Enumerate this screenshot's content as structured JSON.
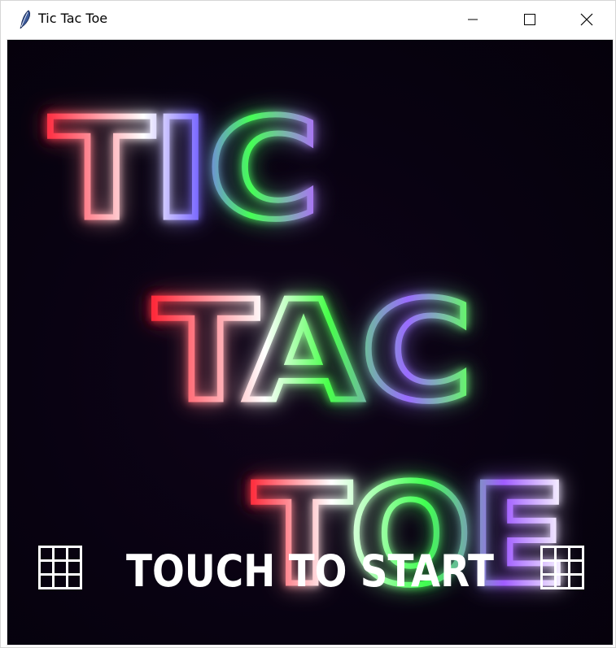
{
  "window": {
    "title": "Tic Tac Toe",
    "app_icon": "feather-icon",
    "controls": [
      "minimize-icon",
      "maximize-icon",
      "close-icon"
    ]
  },
  "game": {
    "title_lines": [
      "TIC",
      "TAC",
      "TOE"
    ],
    "start_prompt": "TOUCH TO START",
    "colors": {
      "background": "#080211",
      "neon_red": "#ff2a3a",
      "neon_green": "#3cff4a",
      "neon_purple": "#a45cff",
      "neon_white": "#ffffff"
    },
    "decor_icons": [
      "tic-tac-toe-grid-icon",
      "tic-tac-toe-grid-icon"
    ]
  }
}
